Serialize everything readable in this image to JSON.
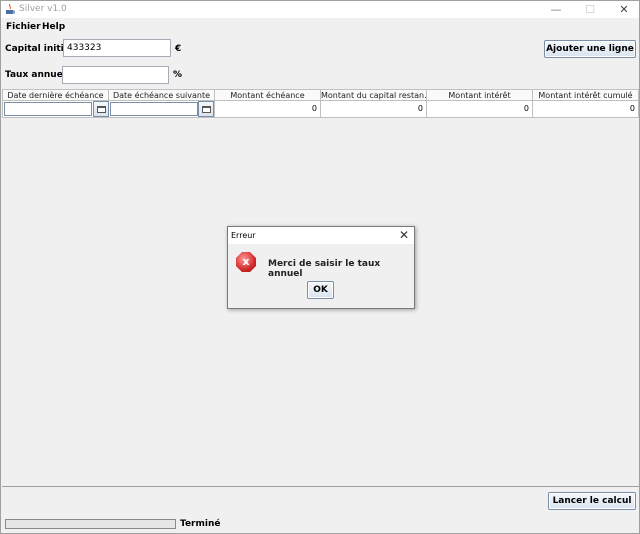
{
  "window": {
    "title": "Silver v1.0",
    "minimize": "—",
    "maximize": "☐",
    "close": "✕"
  },
  "menu": {
    "items": [
      "Fichier",
      "Help"
    ]
  },
  "form": {
    "capital_label": "Capital initial :",
    "capital_value": "433323",
    "capital_unit": "€",
    "taux_label": "Taux annuel :",
    "taux_value": "",
    "taux_unit": "%",
    "add_button": "Ajouter une ligne"
  },
  "table": {
    "columns": [
      "Date dernière échéance",
      "Date échéance suivante",
      "Montant échéance",
      "Montant du capital restan...",
      "Montant intérêt",
      "Montant intérêt cumulé"
    ],
    "rows": [
      {
        "date_last": "",
        "date_next": "",
        "montant": "0",
        "capital": "0",
        "interet": "0",
        "interet_cumule": "0"
      }
    ]
  },
  "dialog": {
    "title": "Erreur",
    "icon": "error-icon",
    "icon_glyph": "x",
    "message": "Merci de saisir le taux annuel",
    "ok": "OK",
    "close": "✕"
  },
  "footer": {
    "calc_button": "Lancer le calcul",
    "status": "Terminé",
    "progress_percent": 0
  },
  "colors": {
    "progress": "#06b025",
    "error": "#d42a2a"
  }
}
